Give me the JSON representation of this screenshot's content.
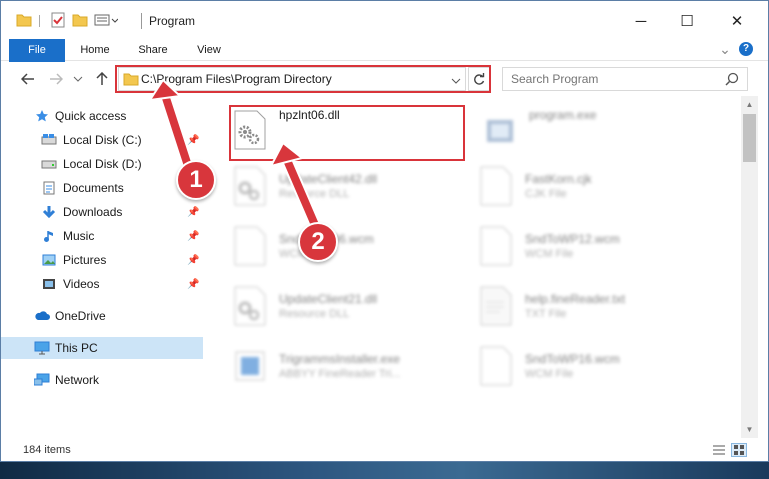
{
  "window": {
    "title": "Program",
    "controls": {
      "minimize": "─",
      "maximize": "☐",
      "close": "✕"
    }
  },
  "quick_access_toolbar": {
    "icons": [
      "folder-icon",
      "properties-icon",
      "new-folder-icon",
      "customize-icon"
    ]
  },
  "ribbon": {
    "tabs": [
      {
        "label": "File"
      },
      {
        "label": "Home"
      },
      {
        "label": "Share"
      },
      {
        "label": "View"
      }
    ],
    "expand_glyph": "⌄",
    "help_glyph": "?"
  },
  "navigation": {
    "address_path": "C:\\Program Files\\Program Directory",
    "search_placeholder": "Search Program"
  },
  "sidebar": {
    "items": [
      {
        "label": "Quick access",
        "icon": "star-icon",
        "pinned": false
      },
      {
        "label": "Local Disk (C:)",
        "icon": "drive-icon",
        "pinned": true
      },
      {
        "label": "Local Disk (D:)",
        "icon": "drive-icon",
        "pinned": false
      },
      {
        "label": "Documents",
        "icon": "documents-icon",
        "pinned": true
      },
      {
        "label": "Downloads",
        "icon": "download-icon",
        "pinned": true
      },
      {
        "label": "Music",
        "icon": "music-icon",
        "pinned": true
      },
      {
        "label": "Pictures",
        "icon": "pictures-icon",
        "pinned": true
      },
      {
        "label": "Videos",
        "icon": "videos-icon",
        "pinned": true
      },
      {
        "label": "OneDrive",
        "icon": "cloud-icon",
        "pinned": false
      },
      {
        "label": "This PC",
        "icon": "computer-icon",
        "pinned": false,
        "selected": true
      },
      {
        "label": "Network",
        "icon": "network-icon",
        "pinned": false
      }
    ]
  },
  "files": [
    {
      "name": "hpzlnt06.dll",
      "type": "",
      "icon": "dll-gear-icon",
      "highlighted": true
    },
    {
      "name": "program.exe",
      "type": "",
      "icon": "exe-icon"
    },
    {
      "name": "UpdateClient42.dll",
      "type": "Resource DLL",
      "icon": "dll-gear-icon"
    },
    {
      "name": "FastKorn.cjk",
      "type": "CJK File",
      "icon": "blank-file-icon"
    },
    {
      "name": "SndToWP06.wcm",
      "type": "WCM File",
      "icon": "blank-file-icon"
    },
    {
      "name": "SndToWP12.wcm",
      "type": "WCM File",
      "icon": "blank-file-icon"
    },
    {
      "name": "UpdateClient21.dll",
      "type": "Resource DLL",
      "icon": "dll-gear-icon"
    },
    {
      "name": "help.fineReader.txt",
      "type": "TXT File",
      "icon": "text-file-icon"
    },
    {
      "name": "TrigrammsInstaller.exe",
      "type": "ABBYY FineReader Tri...",
      "icon": "installer-icon"
    },
    {
      "name": "SndToWP16.wcm",
      "type": "WCM File",
      "icon": "blank-file-icon"
    }
  ],
  "status_bar": {
    "item_count": "184 items"
  },
  "callouts": {
    "step1": "1",
    "step2": "2"
  },
  "colors": {
    "accent": "#1a6fc9",
    "highlight_border": "#d9343a",
    "callout_fill": "#d8363c",
    "selected_row": "#cce4f7"
  }
}
